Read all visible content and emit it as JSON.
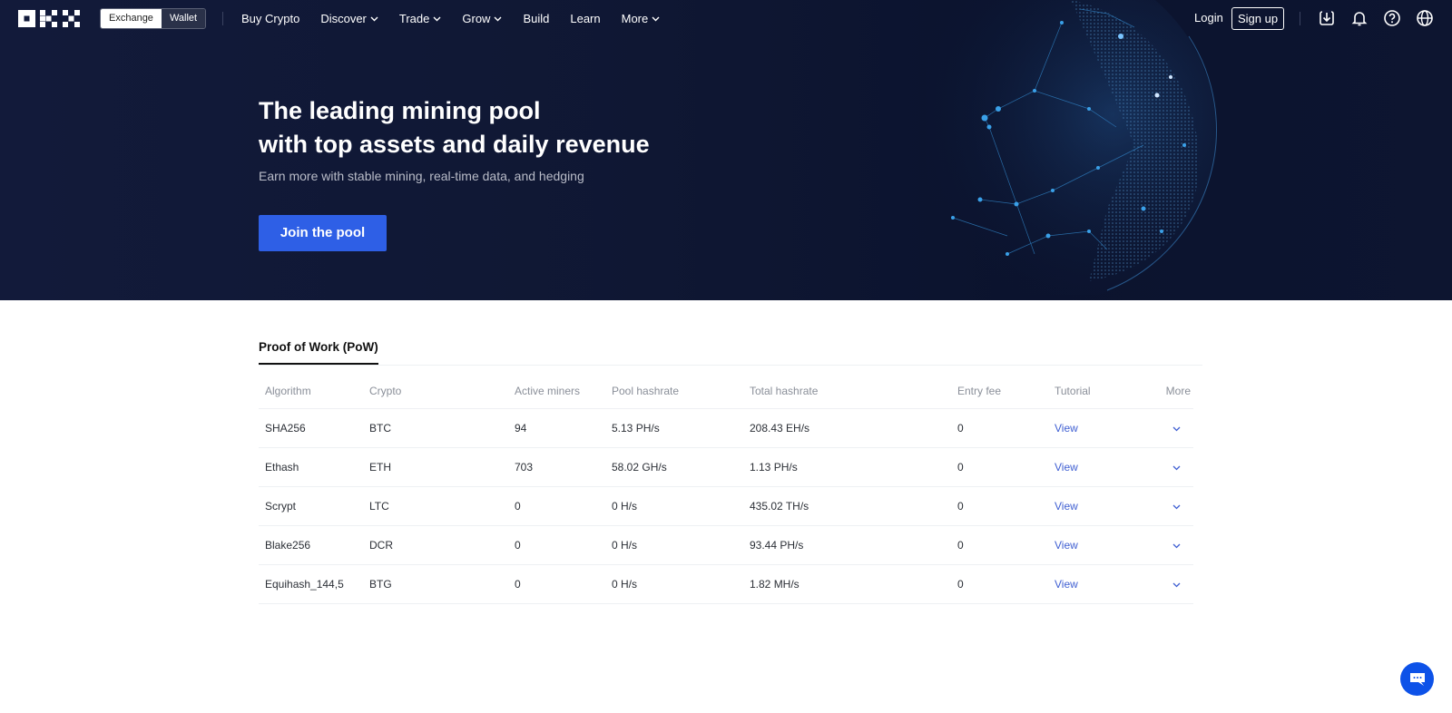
{
  "nav": {
    "logo": "OKX",
    "switch": [
      "Exchange",
      "Wallet"
    ],
    "links": [
      {
        "label": "Buy Crypto",
        "dropdown": false
      },
      {
        "label": "Discover",
        "dropdown": true
      },
      {
        "label": "Trade",
        "dropdown": true
      },
      {
        "label": "Grow",
        "dropdown": true
      },
      {
        "label": "Build",
        "dropdown": false
      },
      {
        "label": "Learn",
        "dropdown": false
      },
      {
        "label": "More",
        "dropdown": true
      }
    ],
    "login": "Login",
    "signup": "Sign up",
    "icons": [
      "download-icon",
      "bell-icon",
      "help-icon",
      "globe-icon"
    ]
  },
  "hero": {
    "title_line1": "The leading mining pool",
    "title_line2": "with top assets and daily revenue",
    "subtitle": "Earn more with stable mining, real-time data, and hedging",
    "cta": "Join the pool"
  },
  "tabs": [
    {
      "label": "Proof of Work (PoW)",
      "active": true
    }
  ],
  "table": {
    "headers": [
      "Algorithm",
      "Crypto",
      "Active miners",
      "Pool hashrate",
      "Total hashrate",
      "Entry fee",
      "Tutorial",
      "More"
    ],
    "rows": [
      {
        "algorithm": "SHA256",
        "crypto": "BTC",
        "miners": "94",
        "pool": "5.13 PH/s",
        "total": "208.43 EH/s",
        "fee": "0",
        "tutorial": "View"
      },
      {
        "algorithm": "Ethash",
        "crypto": "ETH",
        "miners": "703",
        "pool": "58.02 GH/s",
        "total": "1.13 PH/s",
        "fee": "0",
        "tutorial": "View"
      },
      {
        "algorithm": "Scrypt",
        "crypto": "LTC",
        "miners": "0",
        "pool": "0 H/s",
        "total": "435.02 TH/s",
        "fee": "0",
        "tutorial": "View"
      },
      {
        "algorithm": "Blake256",
        "crypto": "DCR",
        "miners": "0",
        "pool": "0 H/s",
        "total": "93.44 PH/s",
        "fee": "0",
        "tutorial": "View"
      },
      {
        "algorithm": "Equihash_144,5",
        "crypto": "BTG",
        "miners": "0",
        "pool": "0 H/s",
        "total": "1.82 MH/s",
        "fee": "0",
        "tutorial": "View"
      }
    ]
  },
  "colors": {
    "accent": "#2e5fe6",
    "link": "#3f5fd2",
    "hero_bg": "#0f1733",
    "chat": "#0d52e8"
  }
}
